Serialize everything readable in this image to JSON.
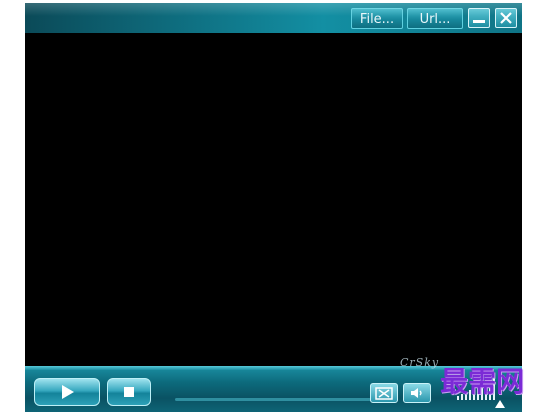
{
  "titlebar": {
    "file_label": "File...",
    "url_label": "Url...",
    "minimize_icon": "minimize-icon",
    "close_icon": "close-icon"
  },
  "controls": {
    "play_icon": "play-icon",
    "stop_icon": "stop-icon",
    "fullscreen_icon": "fullscreen-icon",
    "volume_icon": "speaker-icon"
  },
  "watermark": {
    "small": "CrSky",
    "big": "最需网"
  },
  "colors": {
    "accent": "#138fa3",
    "video_bg": "#000000",
    "watermark": "#7b2bd6"
  }
}
